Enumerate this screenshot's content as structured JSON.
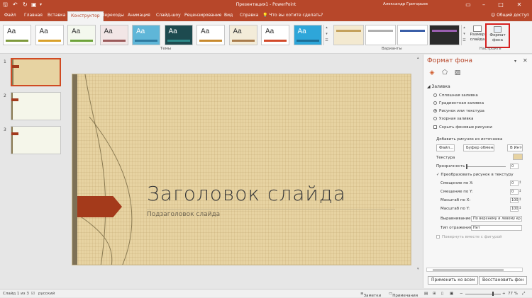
{
  "titlebar": {
    "title": "Презентация1 - PowerPoint",
    "user": "Александр Григорьев",
    "quick_access": [
      "save-icon",
      "undo-icon",
      "redo-icon",
      "present-icon",
      "customize-icon"
    ],
    "window_controls": [
      "ribbon-options-icon",
      "minimize-icon",
      "maximize-icon",
      "close-icon"
    ]
  },
  "tabs": [
    {
      "label": "Файл"
    },
    {
      "label": "Главная"
    },
    {
      "label": "Вставка"
    },
    {
      "label": "Конструктор",
      "active": true
    },
    {
      "label": "Переходы"
    },
    {
      "label": "Анимация"
    },
    {
      "label": "Слайд-шоу"
    },
    {
      "label": "Рецензирование"
    },
    {
      "label": "Вид"
    },
    {
      "label": "Справка"
    }
  ],
  "tell_me": "Что вы хотите сделать?",
  "share": "Общий доступ",
  "ribbon": {
    "themes_label": "Темы",
    "variants_label": "Варианты",
    "customize_label": "Настроить",
    "themes": [
      {
        "text": "Aa",
        "bg": "#ffffff",
        "fg": "#333333",
        "accent": "#7f9a3c"
      },
      {
        "text": "Aa",
        "bg": "#ffffff",
        "fg": "#333333",
        "accent": "#d9a12b"
      },
      {
        "text": "Aa",
        "bg": "#f4f8ee",
        "fg": "#333333",
        "accent": "#6ea33a"
      },
      {
        "text": "Aa",
        "bg": "#f2e6e6",
        "fg": "#333333",
        "accent": "#9b5a5a"
      },
      {
        "text": "Aa",
        "bg": "#5fb6d8",
        "fg": "#ffffff",
        "accent": "#2e7aa0"
      },
      {
        "text": "Aa",
        "bg": "#1d4a4f",
        "fg": "#ffffff",
        "accent": "#2d8a8a"
      },
      {
        "text": "Aa",
        "bg": "#ffffff",
        "fg": "#333333",
        "accent": "#c88a2e"
      },
      {
        "text": "Aa",
        "bg": "#f3ecd9",
        "fg": "#333333",
        "accent": "#a97c4b"
      },
      {
        "text": "Aa",
        "bg": "#ffffff",
        "fg": "#333333",
        "accent": "#d24a2a"
      },
      {
        "text": "Aa",
        "bg": "#2ea6d9",
        "fg": "#ffffff",
        "accent": "#1c6f98"
      }
    ],
    "variants": [
      {
        "bg": "#f3e9d0",
        "strip": "#c4a15c"
      },
      {
        "bg": "#ffffff",
        "strip": "#b0b0b0"
      },
      {
        "bg": "#ffffff",
        "strip": "#3b5fa8"
      },
      {
        "bg": "#2b2b2b",
        "strip": "#9a5fb0"
      }
    ],
    "slide_size_label": [
      "Размер",
      "слайда"
    ],
    "format_background_label": [
      "Формат",
      "фона"
    ]
  },
  "thumbnails": [
    {
      "number": "1",
      "bg": "#e7d3a2",
      "selected": true
    },
    {
      "number": "2",
      "bg": "#f5f6ea",
      "selected": false
    },
    {
      "number": "3",
      "bg": "#f5f6ea",
      "selected": false
    }
  ],
  "slide": {
    "title": "Заголовок слайда",
    "subtitle": "Подзаголовок слайда"
  },
  "pane": {
    "title": "Формат фона",
    "icons": [
      "fill-icon",
      "effects-icon",
      "picture-icon"
    ],
    "section": "Заливка",
    "fill_options": [
      {
        "label": "Сплошная заливка",
        "selected": false
      },
      {
        "label": "Градиентная заливка",
        "selected": false
      },
      {
        "label": "Рисунок или текстура",
        "selected": true
      },
      {
        "label": "Узорная заливка",
        "selected": false
      }
    ],
    "hide_bg_graphics": "Скрыть фоновые рисунки",
    "insert_from": "Добавить рисунок из источника",
    "btn_file": "Файл...",
    "btn_clipboard": "Буфер обмена",
    "btn_online": "В Инте",
    "texture_label": "Текстура",
    "transparency_label": "Прозрачность",
    "transparency_value": "0 %",
    "tile_as_texture": "Преобразовать рисунок в текстуру",
    "offset_x_label": "Смещение по X:",
    "offset_x_value": "0 пт",
    "offset_y_label": "Смещение по Y:",
    "offset_y_value": "0 пт",
    "scale_x_label": "Масштаб по X:",
    "scale_x_value": "100",
    "scale_y_label": "Масштаб по Y:",
    "scale_y_value": "100",
    "alignment_label": "Выравнивание",
    "alignment_value": "По верхнему и левому кр",
    "mirror_label": "Тип отражения",
    "mirror_value": "Нет",
    "rotate_with_shape": "Повернуть вместе с фигурой",
    "apply_all": "Применить ко всем",
    "reset": "Восстановить фон"
  },
  "status": {
    "slide_info": "Слайд 1 из 3",
    "language": "русский",
    "notes": "Заметки",
    "comments": "Примечания",
    "zoom": "77 %"
  }
}
